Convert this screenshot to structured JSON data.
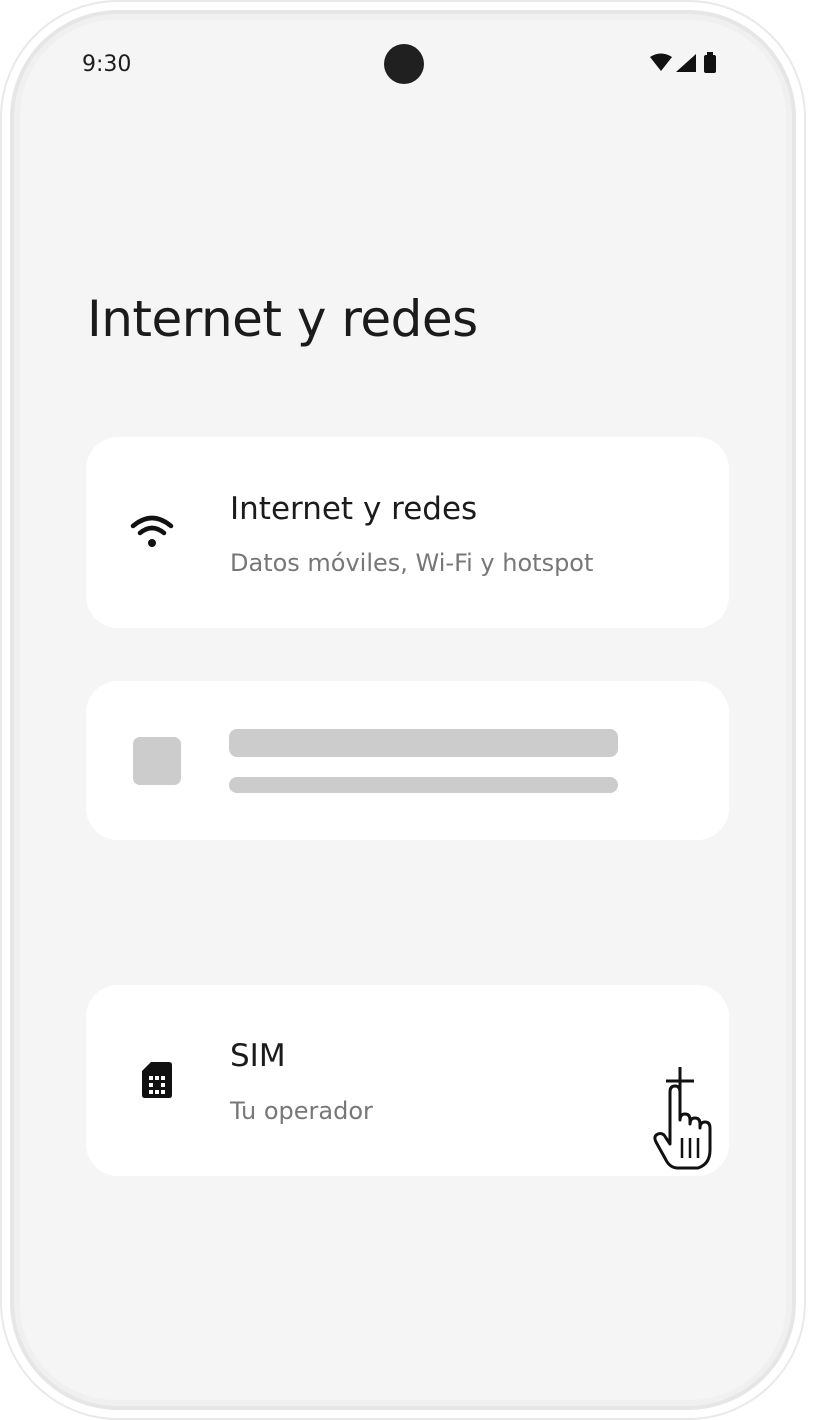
{
  "status_bar": {
    "time": "9:30",
    "icons": [
      "wifi-signal-icon",
      "cell-signal-icon",
      "battery-icon"
    ]
  },
  "page": {
    "title": "Internet y redes"
  },
  "cards": {
    "internet": {
      "icon": "wifi-icon",
      "title": "Internet y redes",
      "subtitle": "Datos móviles, Wi-Fi y hotspot"
    },
    "placeholder": {
      "icon": "placeholder-square"
    },
    "sim": {
      "icon": "sim-card-icon",
      "title": "SIM",
      "subtitle": "Tu operador",
      "action_icon": "plus-icon"
    }
  },
  "cursor": {
    "icon": "hand-pointer-icon"
  },
  "colors": {
    "screen_bg": "#f5f5f5",
    "card_bg": "#ffffff",
    "placeholder": "#cccccc",
    "text_primary": "#1b1b1b",
    "text_secondary": "#777777"
  }
}
